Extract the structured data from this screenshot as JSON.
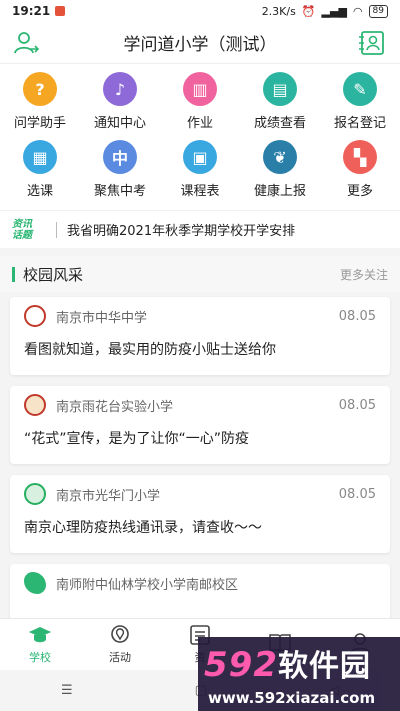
{
  "statusbar": {
    "time": "19:21",
    "speed": "2.3K/s",
    "battery": "89"
  },
  "header": {
    "title": "学问道小学（测试）"
  },
  "grid": [
    {
      "label": "问学助手",
      "icon": "help-icon",
      "glyph": "?",
      "color": "#f5a623"
    },
    {
      "label": "通知中心",
      "icon": "microphone-icon",
      "glyph": "♪",
      "color": "#8e6ad8"
    },
    {
      "label": "作业",
      "icon": "book-icon",
      "glyph": "▥",
      "color": "#f0639e"
    },
    {
      "label": "成绩查看",
      "icon": "bar-chart-icon",
      "glyph": "▤",
      "color": "#2bb5a0"
    },
    {
      "label": "报名登记",
      "icon": "edit-icon",
      "glyph": "✎",
      "color": "#2bb5a0"
    },
    {
      "label": "选课",
      "icon": "calculator-icon",
      "glyph": "▦",
      "color": "#3aa8e0"
    },
    {
      "label": "聚焦中考",
      "icon": "search-icon",
      "glyph": "中",
      "color": "#5b8be0"
    },
    {
      "label": "课程表",
      "icon": "calendar-icon",
      "glyph": "▣",
      "color": "#3aa8e0"
    },
    {
      "label": "健康上报",
      "icon": "lungs-icon",
      "glyph": "❦",
      "color": "#2a7fa8"
    },
    {
      "label": "更多",
      "icon": "more-grid-icon",
      "glyph": "▚",
      "color": "#f0605a"
    }
  ],
  "news": {
    "tag_line1": "资讯",
    "tag_line2": "话题",
    "text": "我省明确2021年秋季学期学校开学安排"
  },
  "section": {
    "title": "校园风采",
    "more": "更多关注"
  },
  "cards": [
    {
      "school": "南京市中华中学",
      "date": "08.05",
      "headline": "看图就知道，最实用的防疫小贴士送给你",
      "logo_color": "#c0392b"
    },
    {
      "school": "南京雨花台实验小学",
      "date": "08.05",
      "headline": "“花式”宣传，是为了让你“一心”防疫",
      "logo_color": "#c0392b"
    },
    {
      "school": "南京市光华门小学",
      "date": "08.05",
      "headline": "南京心理防疫热线通讯录，请查收～～",
      "logo_color": "#27ae60"
    },
    {
      "school": "南师附中仙林学校小学南邮校区",
      "date": "",
      "headline": "",
      "logo_color": "#27ae60"
    }
  ],
  "tabs": [
    {
      "label": "学校",
      "icon": "graduation-cap-icon",
      "active": true
    },
    {
      "label": "活动",
      "icon": "location-pin-icon",
      "active": false
    },
    {
      "label": "资",
      "icon": "news-icon",
      "active": false
    },
    {
      "label": "",
      "icon": "book-open-icon",
      "active": false
    },
    {
      "label": "",
      "icon": "user-icon",
      "active": false
    }
  ],
  "navbar": {
    "menu": "☰",
    "home": "▢",
    "back": "◁"
  },
  "watermark": {
    "big": "592",
    "cn": "软件园",
    "small": "www.592xiazai.com"
  }
}
